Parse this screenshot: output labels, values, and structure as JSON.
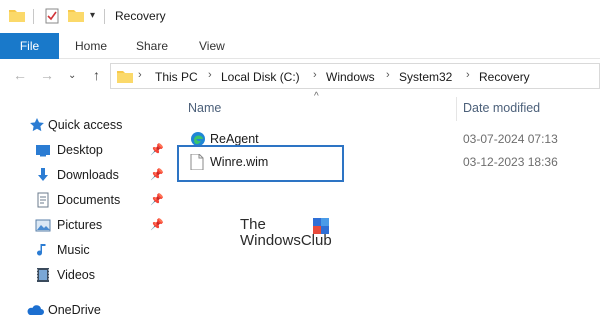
{
  "window": {
    "title": "Recovery"
  },
  "ribbon": {
    "tabs": [
      "File",
      "Home",
      "Share",
      "View"
    ]
  },
  "address": {
    "crumbs": [
      "This PC",
      "Local Disk (C:)",
      "Windows",
      "System32",
      "Recovery"
    ]
  },
  "nav": {
    "items": [
      {
        "label": "Quick access",
        "icon": "star-icon"
      },
      {
        "label": "Desktop",
        "icon": "desktop-icon",
        "pinned": true
      },
      {
        "label": "Downloads",
        "icon": "download-icon",
        "pinned": true
      },
      {
        "label": "Documents",
        "icon": "documents-icon",
        "pinned": true
      },
      {
        "label": "Pictures",
        "icon": "pictures-icon",
        "pinned": true
      },
      {
        "label": "Music",
        "icon": "music-icon"
      },
      {
        "label": "Videos",
        "icon": "videos-icon"
      },
      {
        "label": "OneDrive",
        "icon": "cloud-icon"
      }
    ]
  },
  "list": {
    "columns": [
      "Name",
      "Date modified"
    ],
    "rows": [
      {
        "name": "ReAgent",
        "date": "03-07-2024 07:13",
        "icon": "edge-file-icon"
      },
      {
        "name": "Winre.wim",
        "date": "03-12-2023 18:36",
        "icon": "file-icon"
      }
    ]
  },
  "watermark": {
    "line1": "The",
    "line2": "WindowsClub"
  },
  "colors": {
    "file_tab": "#1979ca",
    "highlight_border": "#2d74c4",
    "folder": "#f7c94b"
  }
}
